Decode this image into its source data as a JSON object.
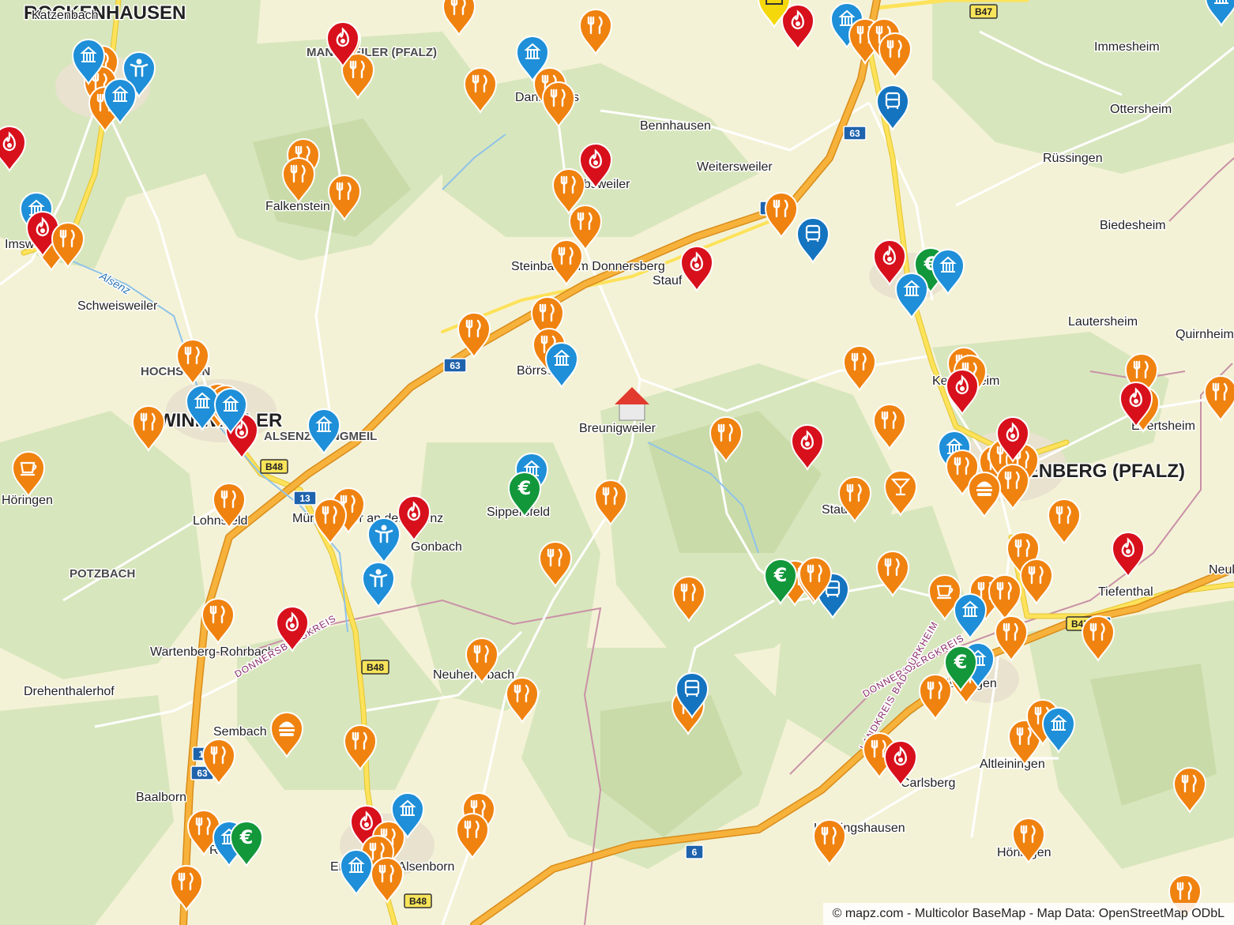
{
  "attribution": "© mapz.com - Multicolor BaseMap - Map Data: OpenStreetMap ODbL",
  "colors": {
    "restaurant": "#f0820f",
    "culture": "#1e8fd8",
    "fuel": "#d7101c",
    "bank": "#12973a",
    "bus": "#1474c0",
    "mail": "#f5d80b",
    "cafe": "#f0820f",
    "bar": "#f0820f",
    "fastfood": "#f0820f",
    "leisure": "#1e8fd8",
    "home": "#e23a2e"
  },
  "places": [
    {
      "name": "ROCKENHAUSEN",
      "kind": "town"
    },
    {
      "name": "WINNWEILER",
      "kind": "town"
    },
    {
      "name": "EISENBERG (PFALZ)",
      "kind": "town"
    },
    {
      "name": "MANNWEILER (PFALZ)",
      "kind": "district"
    },
    {
      "name": "HOCHSTEIN",
      "kind": "district"
    },
    {
      "name": "ALSENZ-LANGMEIL",
      "kind": "district"
    },
    {
      "name": "POTZBACH",
      "kind": "district"
    },
    {
      "name": "Katzenbach",
      "kind": "village"
    },
    {
      "name": "Dannenfels",
      "kind": "village"
    },
    {
      "name": "Bennhausen",
      "kind": "village"
    },
    {
      "name": "Immesheim",
      "kind": "village"
    },
    {
      "name": "Ottersheim",
      "kind": "village"
    },
    {
      "name": "Rüssingen",
      "kind": "village"
    },
    {
      "name": "Weitersweiler",
      "kind": "village"
    },
    {
      "name": "Biedesheim",
      "kind": "village"
    },
    {
      "name": "Falkenstein",
      "kind": "village"
    },
    {
      "name": "Jakobsweiler",
      "kind": "village"
    },
    {
      "name": "Steinbach am Donnersberg",
      "kind": "village"
    },
    {
      "name": "Stauf",
      "kind": "village"
    },
    {
      "name": "Imsweiler",
      "kind": "village"
    },
    {
      "name": "Schweisweiler",
      "kind": "village"
    },
    {
      "name": "Lautersheim",
      "kind": "village"
    },
    {
      "name": "Quirnheim",
      "kind": "village"
    },
    {
      "name": "Börrstadt",
      "kind": "village"
    },
    {
      "name": "Kerzenheim",
      "kind": "village"
    },
    {
      "name": "Breunigweiler",
      "kind": "village"
    },
    {
      "name": "Ebertsheim",
      "kind": "village"
    },
    {
      "name": "Höringen",
      "kind": "village"
    },
    {
      "name": "Sippersfeld",
      "kind": "village"
    },
    {
      "name": "Lohnsfeld",
      "kind": "village"
    },
    {
      "name": "Münchweiler an der Alsenz",
      "kind": "village"
    },
    {
      "name": "Gonbach",
      "kind": "village"
    },
    {
      "name": "Stauf",
      "kind": "village"
    },
    {
      "name": "Tiefenthal",
      "kind": "village"
    },
    {
      "name": "Neuleiningen",
      "kind": "village"
    },
    {
      "name": "Wartenberg-Rohrbach",
      "kind": "village"
    },
    {
      "name": "Neuhemsbach",
      "kind": "village"
    },
    {
      "name": "Drehenthalerhof",
      "kind": "village"
    },
    {
      "name": "Sembach",
      "kind": "village"
    },
    {
      "name": "Baalborn",
      "kind": "village"
    },
    {
      "name": "Enkenbach-Alsenborn",
      "kind": "village"
    },
    {
      "name": "Altleiningen",
      "kind": "village"
    },
    {
      "name": "Hertlingshausen",
      "kind": "village"
    },
    {
      "name": "Höningen",
      "kind": "village"
    },
    {
      "name": "Mehlingen",
      "kind": "village"
    },
    {
      "name": "Ramsen",
      "kind": "village"
    },
    {
      "name": "Carlsberg",
      "kind": "village"
    },
    {
      "name": "Stauf",
      "kind": "village"
    },
    {
      "name": "Alsenz",
      "kind": "river"
    }
  ],
  "roads": [
    {
      "ref": "B47"
    },
    {
      "ref": "63"
    },
    {
      "ref": "12"
    },
    {
      "ref": "B48"
    },
    {
      "ref": "13"
    },
    {
      "ref": "B48"
    },
    {
      "ref": "14"
    },
    {
      "ref": "63"
    },
    {
      "ref": "B48"
    },
    {
      "ref": "63"
    },
    {
      "ref": "6"
    },
    {
      "ref": "B47"
    },
    {
      "ref": "6"
    }
  ],
  "boundaries": [
    {
      "label": "DONNERSBERGKREIS"
    },
    {
      "label": "DONNERSBERGKREIS"
    },
    {
      "label": "LANDKREIS BAD DÜRKHEIM"
    }
  ],
  "markers": [
    {
      "category": "restaurant",
      "icon": "fork-knife-icon"
    },
    {
      "category": "culture",
      "icon": "building-icon"
    },
    {
      "category": "fuel",
      "icon": "flame-icon"
    },
    {
      "category": "bank",
      "icon": "euro-icon"
    },
    {
      "category": "bus",
      "icon": "bus-icon"
    },
    {
      "category": "mail",
      "icon": "envelope-icon"
    },
    {
      "category": "cafe",
      "icon": "cup-icon"
    },
    {
      "category": "bar",
      "icon": "cocktail-icon"
    },
    {
      "category": "fastfood",
      "icon": "burger-icon"
    },
    {
      "category": "leisure",
      "icon": "person-icon"
    },
    {
      "category": "home",
      "icon": "house-icon"
    }
  ]
}
